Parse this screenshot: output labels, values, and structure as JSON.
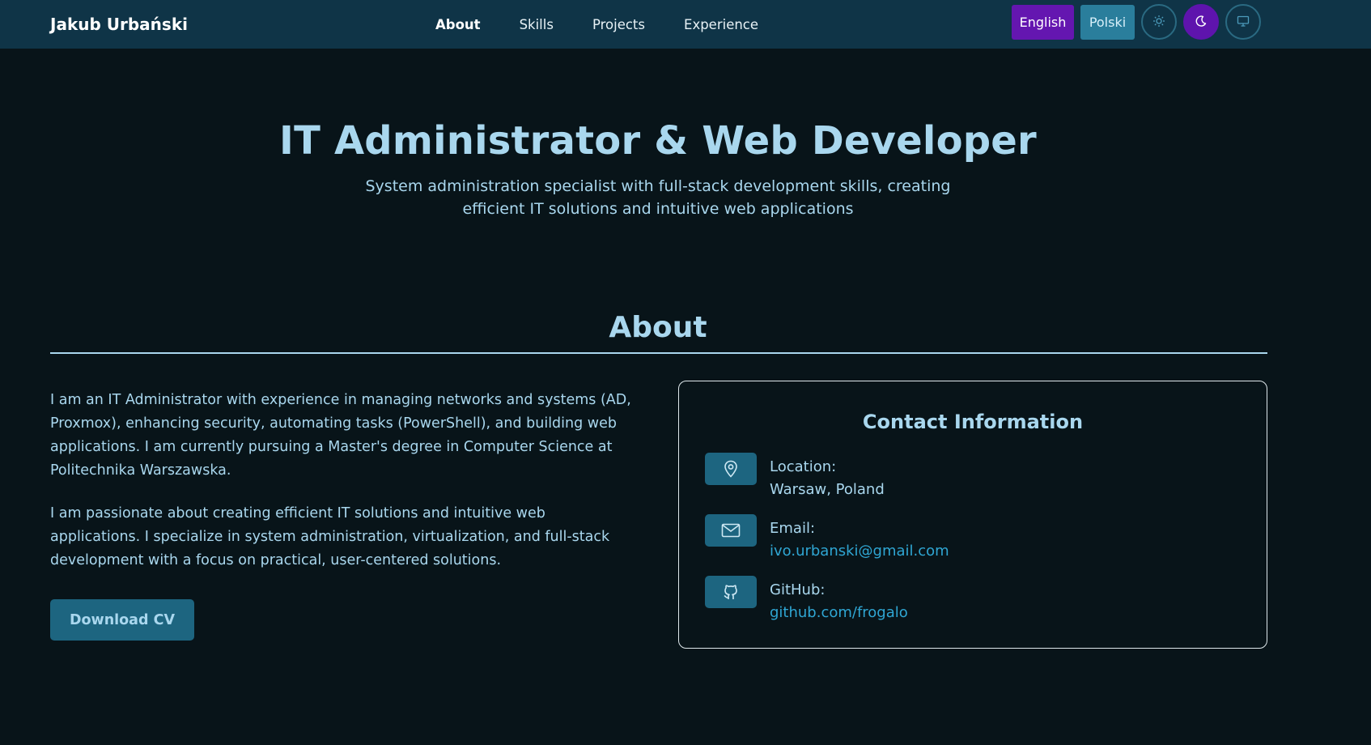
{
  "brand": "Jakub Urbański",
  "nav": {
    "links": [
      "About",
      "Skills",
      "Projects",
      "Experience"
    ]
  },
  "controls": {
    "lang_en": "English",
    "lang_pl": "Polski",
    "icons": [
      "sun-icon",
      "moon-icon",
      "monitor-icon"
    ]
  },
  "hero": {
    "title": "IT Administrator & Web Developer",
    "subtitle": "System administration specialist with full-stack development skills, creating efficient IT solutions and intuitive web applications"
  },
  "about": {
    "title": "About",
    "paragraph1": "I am an IT Administrator with experience in managing networks and systems (AD, Proxmox), enhancing security, automating tasks (PowerShell), and building web applications. I am currently pursuing a Master's degree in Computer Science at Politechnika Warszawska.",
    "paragraph2": "I am passionate about creating efficient IT solutions and intuitive web applications. I specialize in system administration, virtualization, and full-stack development with a focus on practical, user-centered solutions.",
    "cv_button": "Download CV"
  },
  "contact": {
    "title": "Contact Information",
    "location_label": "Location:",
    "location_value": "Warsaw, Poland",
    "email_label": "Email:",
    "email_value": "ivo.urbanski@gmail.com",
    "github_label": "GitHub:",
    "github_value": "github.com/frogalo"
  },
  "colors": {
    "background": "#081419",
    "navbar": "#0f3447",
    "accent_purple": "#6416b0",
    "accent_teal": "#1d6580",
    "text": "#a9d7ee",
    "link": "#2fa6d3"
  }
}
